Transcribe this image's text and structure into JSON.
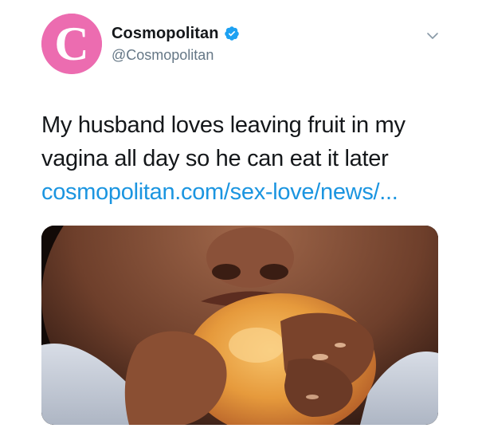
{
  "account": {
    "display_name": "Cosmopolitan",
    "handle": "@Cosmopolitan",
    "avatar_letter": "C",
    "avatar_color": "#ec6cb0",
    "verified": true
  },
  "tweet": {
    "text_line1": "My husband loves leaving fruit in my",
    "text_line2": "vagina all day so he can eat it later",
    "link_text": "cosmopolitan.com/sex-love/news/..."
  },
  "media": {
    "description_icon": "photo-media"
  },
  "colors": {
    "name": "#14171a",
    "handle": "#657786",
    "link": "#1b95e0",
    "verified": "#1da1f2"
  }
}
